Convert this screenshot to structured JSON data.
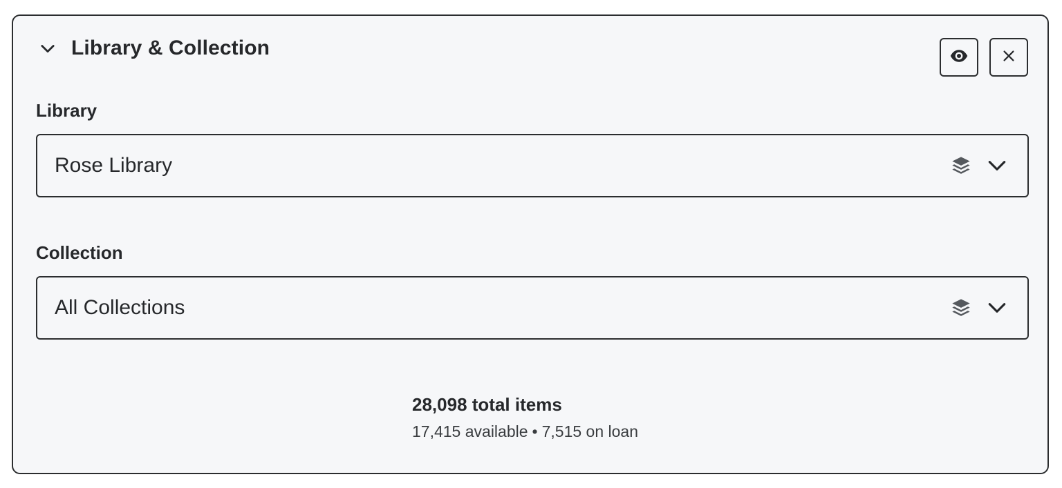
{
  "section": {
    "title": "Library & Collection"
  },
  "library": {
    "label": "Library",
    "selected": "Rose Library"
  },
  "collection": {
    "label": "Collection",
    "selected": "All Collections"
  },
  "summary": {
    "total": "28,098 total items",
    "available": "17,415 available",
    "separator": "•",
    "on_loan": "7,515 on loan"
  },
  "icons": {
    "collapse": "chevron-down-icon",
    "preview": "eye-icon",
    "close": "close-icon",
    "source": "layers-icon",
    "dropdown": "chevron-down-icon"
  },
  "colors": {
    "panel_bg": "#f6f7f9",
    "border": "#2b2d2f",
    "text": "#26282b",
    "icon_gray": "#55595e"
  }
}
